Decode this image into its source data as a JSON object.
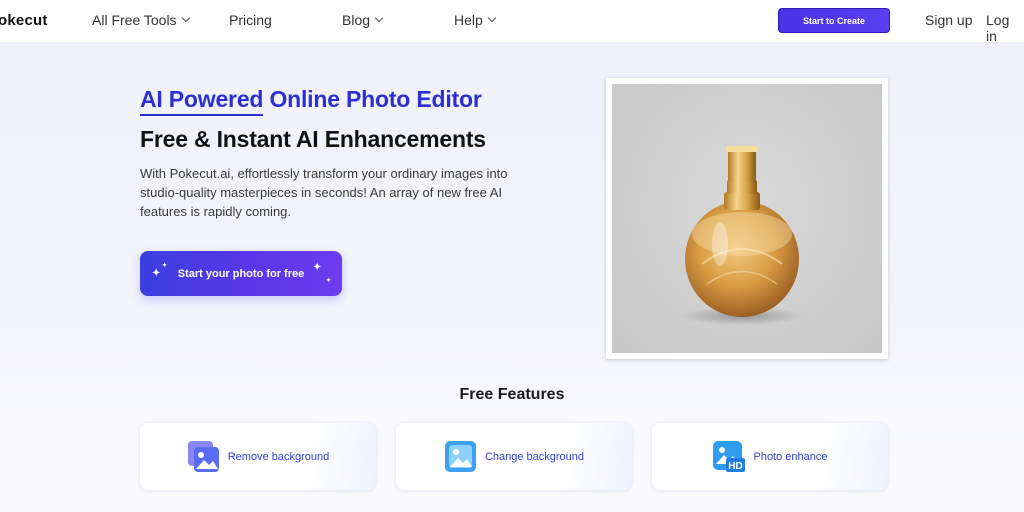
{
  "header": {
    "logo": "okecut",
    "nav": [
      {
        "label": "All Free Tools",
        "has_dropdown": true
      },
      {
        "label": "Pricing",
        "has_dropdown": false
      },
      {
        "label": "Blog",
        "has_dropdown": true
      },
      {
        "label": "Help",
        "has_dropdown": true
      }
    ],
    "cta_label": "Start to Create",
    "signup_label": "Sign up",
    "login_label": "Log in"
  },
  "hero": {
    "title_highlight": "AI Powered",
    "title_rest": " Online Photo Editor",
    "subtitle": "Free & Instant AI Enhancements",
    "description": "With Pokecut.ai, effortlessly transform your ordinary images into studio-quality masterpieces in seconds! An array of new free AI features is rapidly coming.",
    "button_label": "Start your photo for free"
  },
  "features": {
    "title": "Free Features",
    "items": [
      {
        "label": "Remove background",
        "icon": "remove-background-icon"
      },
      {
        "label": "Change background",
        "icon": "change-background-icon"
      },
      {
        "label": "Photo enhance",
        "icon": "photo-enhance-hd-icon"
      }
    ]
  },
  "colors": {
    "brand": "#4a32e6",
    "title_blue": "#2d2fd4",
    "feature_text": "#3240d6"
  }
}
